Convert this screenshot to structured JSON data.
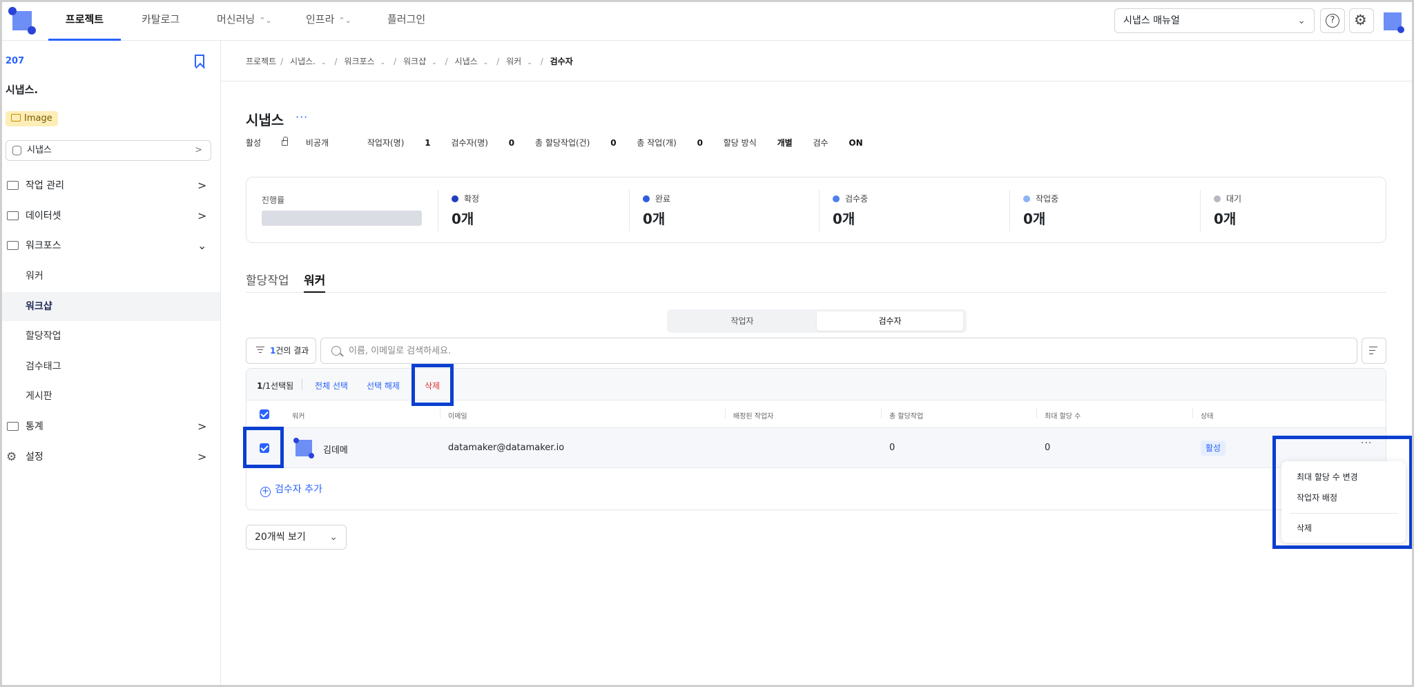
{
  "nav": {
    "tabs": [
      {
        "label": "프로젝트"
      },
      {
        "label": "카탈로그"
      },
      {
        "label": "머신러닝"
      },
      {
        "label": "인프라"
      },
      {
        "label": "플러그인"
      }
    ],
    "manual_select": "시냅스 매뉴얼",
    "help_icon_char": "?",
    "gear_icon_char": "⚙"
  },
  "sidebar": {
    "project_id": "207",
    "project_name": "시냅스.",
    "badge": "Image",
    "dataset": "시냅스",
    "items": [
      {
        "label": "작업 관리"
      },
      {
        "label": "데이터셋"
      },
      {
        "label": "워크포스"
      },
      {
        "label": "통계"
      },
      {
        "label": "설정"
      }
    ],
    "sub_items": [
      {
        "label": "워커"
      },
      {
        "label": "워크샵"
      },
      {
        "label": "할당작업"
      },
      {
        "label": "검수태그"
      },
      {
        "label": "게시판"
      }
    ],
    "chevron_right": ">",
    "chevron_down": "⌄"
  },
  "breadcrumb": {
    "items": [
      "프로젝트",
      "시냅스.",
      "워크포스",
      "워크샵",
      "시냅스",
      "워커"
    ],
    "current": "검수자",
    "separator": "/"
  },
  "header": {
    "title": "시냅스",
    "more": "···",
    "status": "활성",
    "visibility": "비공개",
    "workers_label": "작업자(명)",
    "workers_value": "1",
    "reviewers_label": "검수자(명)",
    "reviewers_value": "0",
    "assigned_label": "총 할당작업(건)",
    "assigned_value": "0",
    "tasks_label": "총 작업(개)",
    "tasks_value": "0",
    "method_label": "할당 방식",
    "method_value": "개별",
    "review_label": "검수",
    "review_value": "ON"
  },
  "progress": {
    "label": "진행률",
    "value_fraction": 0,
    "stats": [
      {
        "label": "확정",
        "value": "0개",
        "color": "#1f3fbf"
      },
      {
        "label": "완료",
        "value": "0개",
        "color": "#2f5be0"
      },
      {
        "label": "검수중",
        "value": "0개",
        "color": "#4f7ff0"
      },
      {
        "label": "작업중",
        "value": "0개",
        "color": "#8db3f5"
      },
      {
        "label": "대기",
        "value": "0개",
        "color": "#b4b9c2"
      }
    ]
  },
  "tabs": [
    {
      "label": "할당작업"
    },
    {
      "label": "워커"
    }
  ],
  "segment": [
    {
      "label": "작업자"
    },
    {
      "label": "검수자"
    }
  ],
  "filter": {
    "count": "1",
    "suffix": "건의 결과"
  },
  "search": {
    "placeholder": "이름, 이메일로 검색하세요."
  },
  "selection": {
    "count": "1",
    "total": "/1",
    "suffix": "선택됨",
    "select_all": "전체 선택",
    "deselect": "선택 해제",
    "delete": "삭제"
  },
  "table": {
    "headers": [
      "워커",
      "이메일",
      "배정된 작업자",
      "총 할당작업",
      "최대 할당 수",
      "상태"
    ],
    "rows": [
      {
        "name": "김데메",
        "email": "datamaker@datamaker.io",
        "assigned_total": "0",
        "max_assign": "0",
        "status": "활성",
        "more": "···"
      }
    ],
    "add_reviewer": "검수자 추가"
  },
  "page_size": "20개씩 보기",
  "context_menu": {
    "items": [
      {
        "label": "최대 할당 수 변경"
      },
      {
        "label": "작업자 배정"
      },
      {
        "label": "삭제"
      }
    ]
  },
  "colors": {
    "accent": "#2962ff",
    "highlight": "#0a3fd0",
    "danger": "#e03131"
  }
}
